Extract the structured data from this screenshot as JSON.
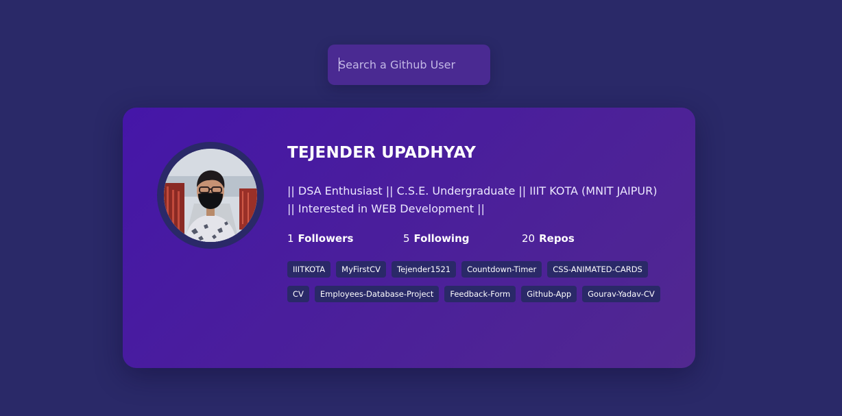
{
  "search": {
    "placeholder": "Search a Github User"
  },
  "profile": {
    "name": "TEJENDER UPADHYAY",
    "bio_line1": "|| DSA Enthusiast || C.S.E. Undergraduate || IIIT KOTA (MNIT JAIPUR)",
    "bio_line2": "|| Interested in WEB Development ||",
    "avatar_icon": "user-avatar-photo"
  },
  "stats": {
    "followers": {
      "value": "1",
      "label": "Followers"
    },
    "following": {
      "value": "5",
      "label": "Following"
    },
    "repos": {
      "value": "20",
      "label": "Repos"
    }
  },
  "repos": [
    "IIITKOTA",
    "MyFirstCV",
    "Tejender1521",
    "Countdown-Timer",
    "CSS-ANIMATED-CARDS",
    "CV",
    "Employees-Database-Project",
    "Feedback-Form",
    "Github-App",
    "Gourav-Yadav-CV"
  ],
  "colors": {
    "background": "#2a2968",
    "card_start": "#4516a8",
    "card_end": "#512890",
    "search_bg": "#4a2a92",
    "chip_bg": "#2a2968"
  }
}
